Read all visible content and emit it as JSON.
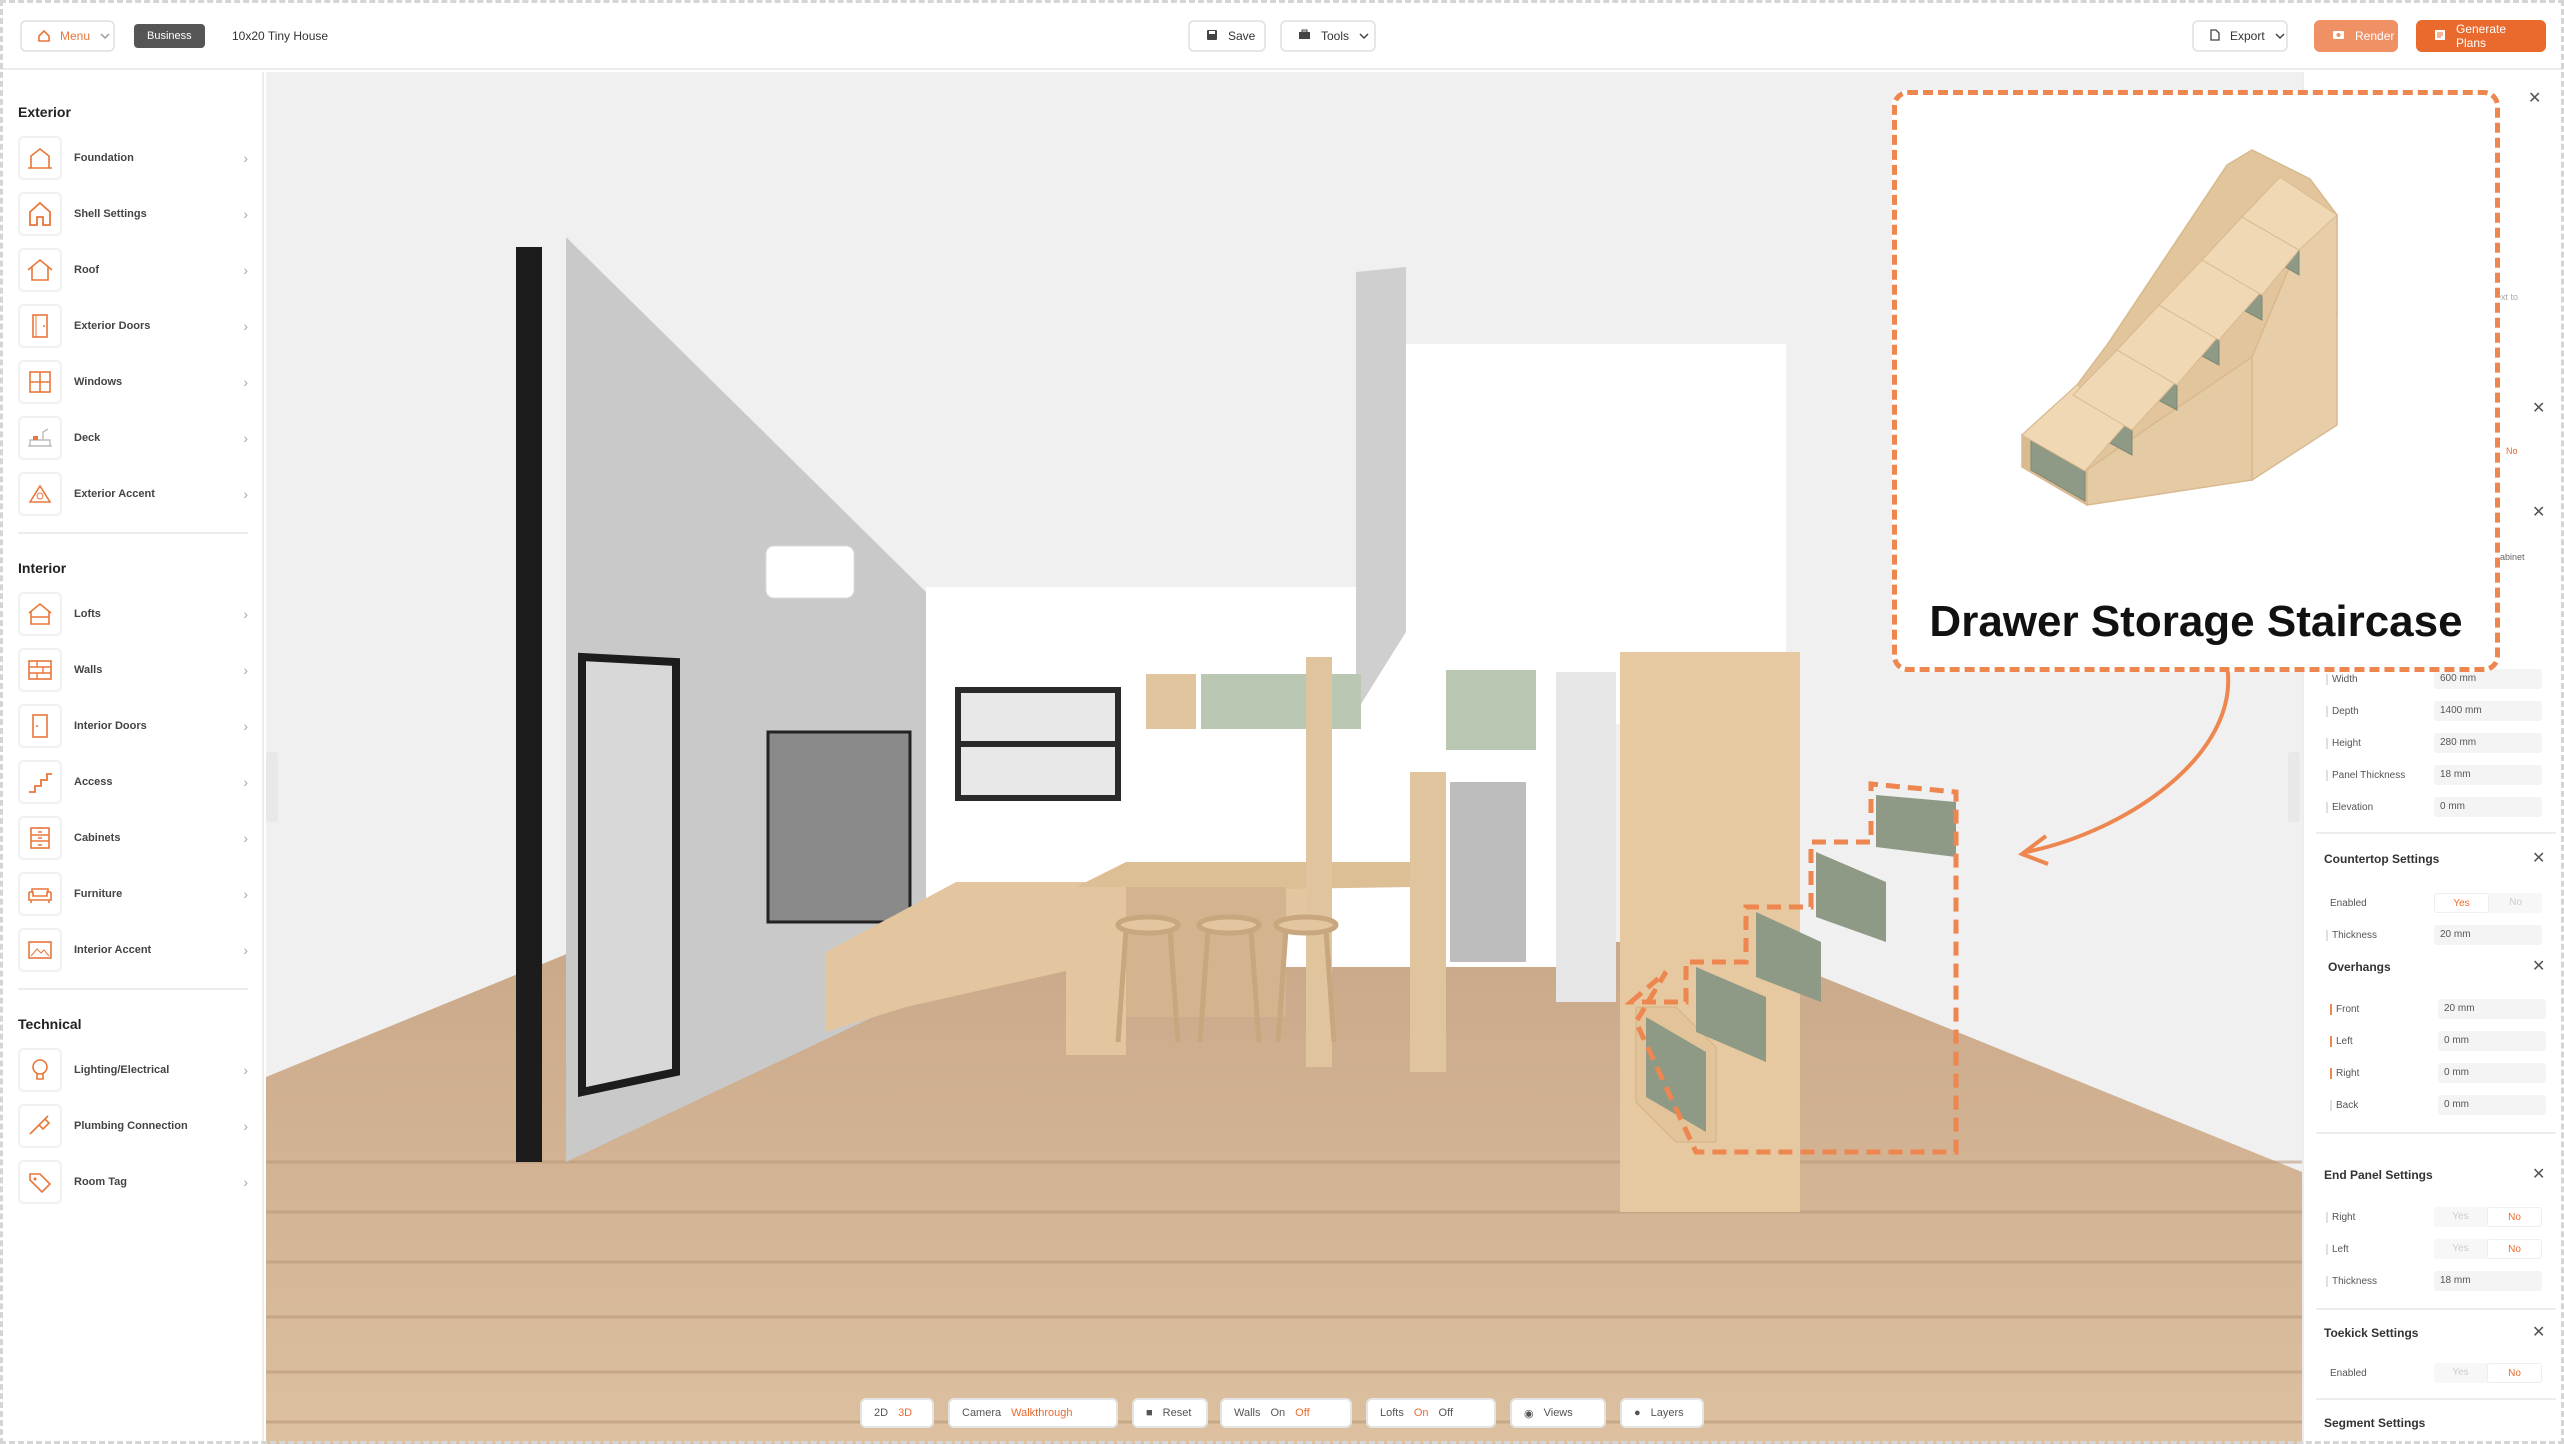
{
  "topbar": {
    "menu_label": "Menu",
    "plan_badge": "Business",
    "project_name": "10x20 Tiny House",
    "save_label": "Save",
    "tools_label": "Tools",
    "export_label": "Export",
    "render_label": "Render",
    "generate_label": "Generate Plans"
  },
  "sidebar": {
    "exterior_title": "Exterior",
    "exterior": [
      {
        "label": "Foundation",
        "icon": "foundation-icon"
      },
      {
        "label": "Shell Settings",
        "icon": "house-shell-icon"
      },
      {
        "label": "Roof",
        "icon": "roof-icon"
      },
      {
        "label": "Exterior Doors",
        "icon": "door-icon"
      },
      {
        "label": "Windows",
        "icon": "window-icon"
      },
      {
        "label": "Deck",
        "icon": "deck-icon"
      },
      {
        "label": "Exterior Accent",
        "icon": "accent-icon"
      }
    ],
    "interior_title": "Interior",
    "interior": [
      {
        "label": "Lofts",
        "icon": "loft-icon"
      },
      {
        "label": "Walls",
        "icon": "wall-icon"
      },
      {
        "label": "Interior Doors",
        "icon": "interior-door-icon"
      },
      {
        "label": "Access",
        "icon": "stairs-icon"
      },
      {
        "label": "Cabinets",
        "icon": "cabinet-icon"
      },
      {
        "label": "Furniture",
        "icon": "sofa-icon"
      },
      {
        "label": "Interior Accent",
        "icon": "picture-icon"
      }
    ],
    "technical_title": "Technical",
    "technical": [
      {
        "label": "Lighting/Electrical",
        "icon": "bulb-icon"
      },
      {
        "label": "Plumbing Connection",
        "icon": "plumbing-icon"
      },
      {
        "label": "Room Tag",
        "icon": "tag-icon"
      }
    ]
  },
  "bottombar": {
    "view_2d": "2D",
    "view_3d": "3D",
    "camera": "Camera",
    "walkthrough": "Walkthrough",
    "reset": "Reset",
    "walls": "Walls",
    "walls_on": "On",
    "walls_off": "Off",
    "lofts": "Lofts",
    "lofts_on": "On",
    "lofts_off": "Off",
    "views": "Views",
    "layers": "Layers"
  },
  "rightpanel": {
    "partial_link": "ext to",
    "partial_no": "No",
    "partial_cabinet": "abinet",
    "dimensions": [
      {
        "label": "Width",
        "value": "600 mm"
      },
      {
        "label": "Depth",
        "value": "1400 mm"
      },
      {
        "label": "Height",
        "value": "280 mm"
      },
      {
        "label": "Panel Thickness",
        "value": "18 mm"
      },
      {
        "label": "Elevation",
        "value": "0 mm"
      }
    ],
    "countertop_title": "Countertop Settings",
    "countertop_enabled": "Enabled",
    "countertop_thickness_label": "Thickness",
    "countertop_thickness_value": "20 mm",
    "overhangs_title": "Overhangs",
    "overhangs": [
      {
        "label": "Front",
        "value": "20 mm"
      },
      {
        "label": "Left",
        "value": "0 mm"
      },
      {
        "label": "Right",
        "value": "0 mm"
      },
      {
        "label": "Back",
        "value": "0 mm"
      }
    ],
    "endpanel_title": "End Panel Settings",
    "endpanel_right": "Right",
    "endpanel_left": "Left",
    "endpanel_thickness_label": "Thickness",
    "endpanel_thickness_value": "18 mm",
    "toekick_title": "Toekick Settings",
    "toekick_enabled": "Enabled",
    "segment_title": "Segment Settings",
    "yes": "Yes",
    "no": "No"
  },
  "callout": {
    "title": "Drawer Storage Staircase"
  },
  "colors": {
    "accent": "#ea6a2e",
    "callout_border": "#ee8650",
    "drawer_green": "#8f9a86",
    "wood": "#e8cfa8"
  }
}
